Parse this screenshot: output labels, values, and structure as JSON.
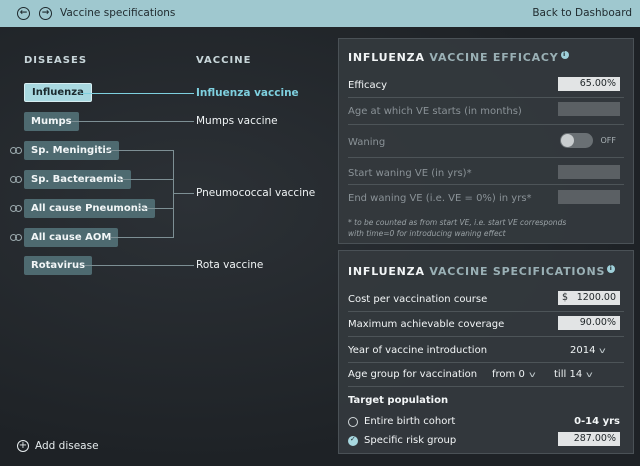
{
  "header": {
    "title": "Vaccine specifications",
    "back_to_dashboard": "Back to Dashboard"
  },
  "diseases_column": {
    "heading": "DISEASES",
    "items": [
      {
        "label": "Influenza",
        "active": true
      },
      {
        "label": "Mumps"
      },
      {
        "label": "Sp. Meningitis"
      },
      {
        "label": "Sp. Bacteraemia"
      },
      {
        "label": "All cause Pneumonia"
      },
      {
        "label": "All cause AOM"
      },
      {
        "label": "Rotavirus"
      }
    ],
    "add_disease": "Add disease"
  },
  "vaccine_column": {
    "heading": "VACCINE",
    "items": [
      {
        "label": "Influenza vaccine",
        "active": true
      },
      {
        "label": "Mumps vaccine"
      },
      {
        "label": "Pneumococcal vaccine"
      },
      {
        "label": "Rota vaccine"
      }
    ]
  },
  "efficacy_panel": {
    "title_main": "INFLUENZA",
    "title_sub": "VACCINE EFFICACY",
    "rows": [
      {
        "label": "Efficacy",
        "value": "65.00%"
      },
      {
        "label": "Age at which VE starts (in months)",
        "value": ""
      },
      {
        "label": "Waning",
        "toggle": "OFF"
      },
      {
        "label": "Start waning VE (in yrs)*",
        "value": ""
      },
      {
        "label": "End waning VE (i.e. VE = 0%) in yrs*",
        "value": ""
      }
    ],
    "note": "* to be counted as from start VE, i.e. start VE corresponds with time=0 for introducing waning effect"
  },
  "specs_panel": {
    "title_main": "INFLUENZA",
    "title_sub": "VACCINE SPECIFICATIONS",
    "cost_label": "Cost per vaccination course",
    "cost_currency": "$",
    "cost_value": "1200.00",
    "coverage_label": "Maximum achievable coverage",
    "coverage_value": "90.00%",
    "year_label": "Year of vaccine introduction",
    "year_value": "2014",
    "age_label": "Age group for vaccination",
    "age_from_label": "from",
    "age_from_value": "0",
    "age_till_label": "till",
    "age_till_value": "14",
    "target_label": "Target population",
    "target_options": [
      {
        "label": "Entire birth cohort",
        "value": "0-14 yrs",
        "checked": false
      },
      {
        "label": "Specific risk group",
        "value": "287.00%",
        "checked": true
      }
    ]
  }
}
